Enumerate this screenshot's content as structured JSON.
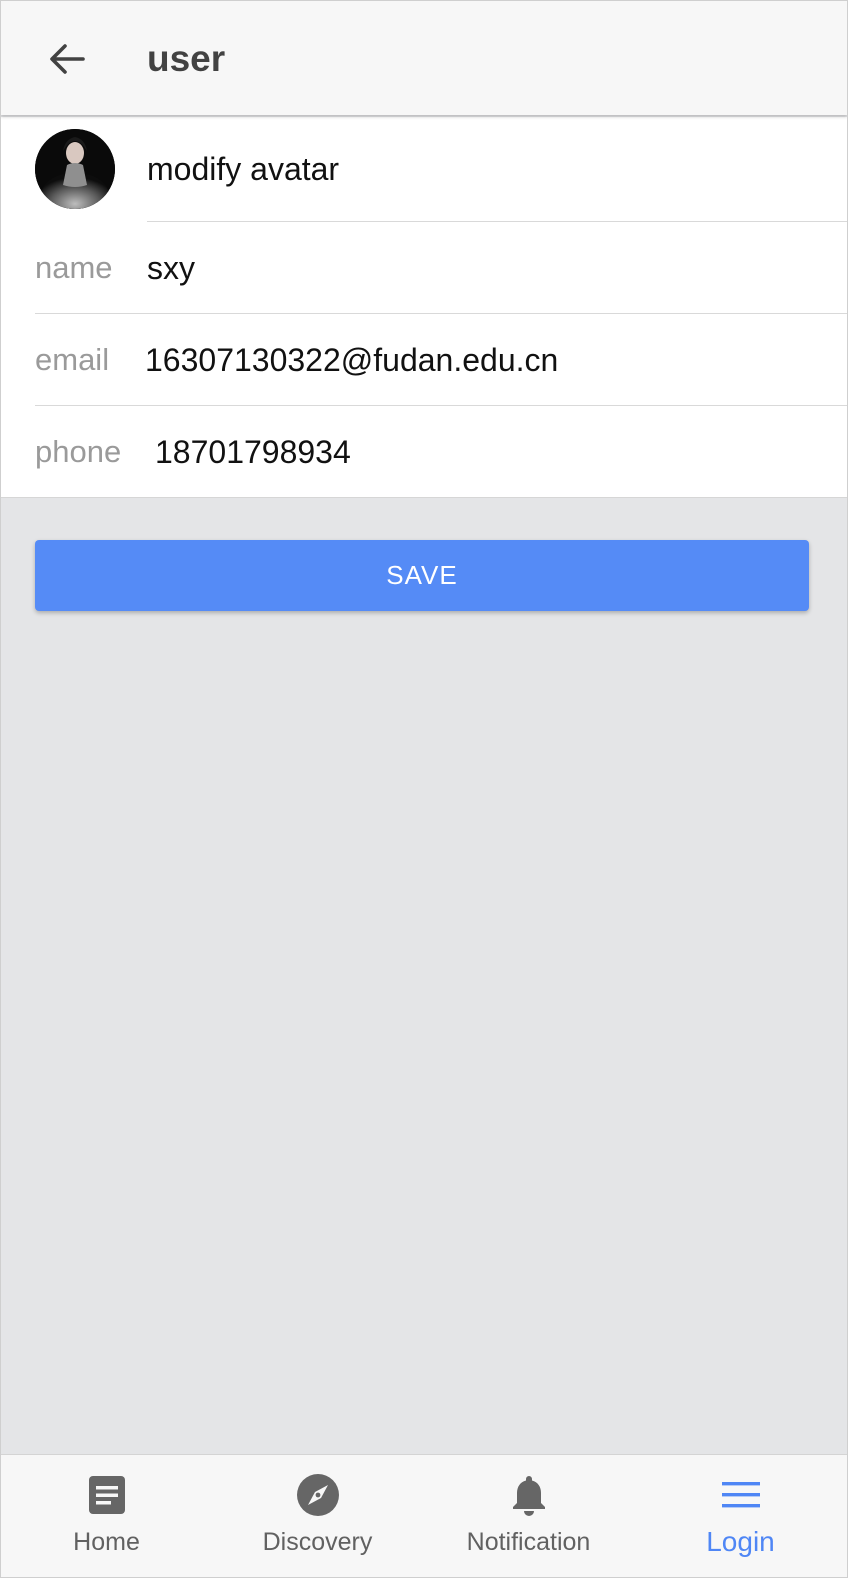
{
  "header": {
    "title": "user",
    "back_icon": "arrow-left-icon"
  },
  "form": {
    "avatar_label": "modify avatar",
    "fields": [
      {
        "label": "name",
        "value": "sxy"
      },
      {
        "label": "email",
        "value": "16307130322@fudan.edu.cn"
      },
      {
        "label": "phone",
        "value": "18701798934"
      }
    ]
  },
  "actions": {
    "save_label": "SAVE"
  },
  "bottom_nav": {
    "items": [
      {
        "label": "Home",
        "icon": "document-icon",
        "active": false
      },
      {
        "label": "Discovery",
        "icon": "compass-icon",
        "active": false
      },
      {
        "label": "Notification",
        "icon": "bell-icon",
        "active": false
      },
      {
        "label": "Login",
        "icon": "menu-icon",
        "active": true
      }
    ]
  },
  "colors": {
    "accent": "#558bf6",
    "nav_active": "#4f86f5",
    "header_bg": "#f7f7f7",
    "page_bg": "#e4e5e7",
    "label_gray": "#9a9a9a"
  }
}
